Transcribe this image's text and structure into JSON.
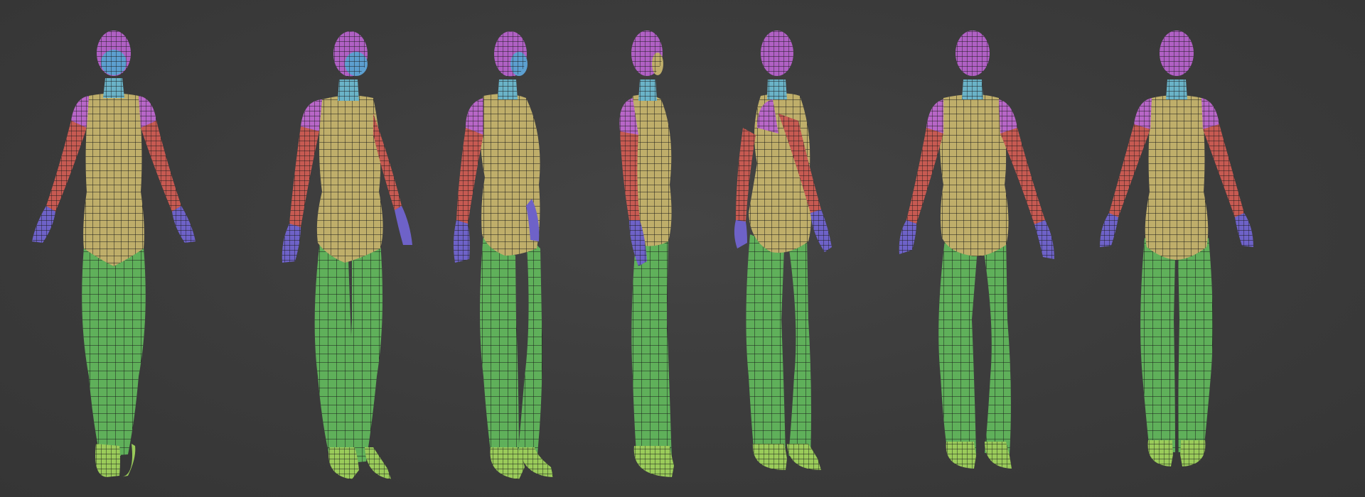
{
  "scene": {
    "background_color": "#3a3a3a",
    "wire_color": "#1a1a1a",
    "region_colors": {
      "head": "#b060c4",
      "face": "#5c9fd0",
      "neck": "#6ab3c8",
      "shoulders": "#b866c8",
      "torso": "#bfae6a",
      "arms": "#c75a52",
      "hands": "#6e62c8",
      "legs": "#5fb05a",
      "feet": "#9acb5a"
    },
    "views": [
      {
        "name": "front",
        "icon": "mesh-figure-front-icon"
      },
      {
        "name": "front-three-quarter",
        "icon": "mesh-figure-three-quarter-icon"
      },
      {
        "name": "front-three-quarter-side",
        "icon": "mesh-figure-three-quarter-icon"
      },
      {
        "name": "side",
        "icon": "mesh-figure-side-icon"
      },
      {
        "name": "back-side",
        "icon": "mesh-figure-back-side-icon"
      },
      {
        "name": "back-three-quarter",
        "icon": "mesh-figure-back-three-quarter-icon"
      },
      {
        "name": "back",
        "icon": "mesh-figure-back-icon"
      }
    ]
  }
}
